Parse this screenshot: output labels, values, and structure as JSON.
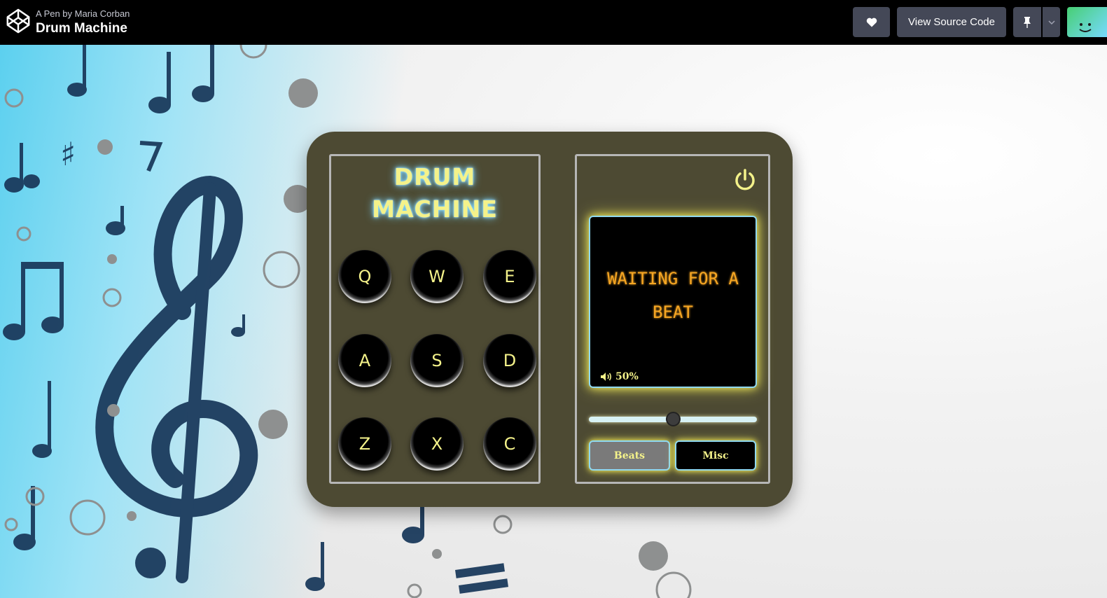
{
  "header": {
    "pen_by": "A Pen by Maria Corban",
    "title": "Drum Machine",
    "heart_icon": "heart-icon",
    "view_source_label": "View Source Code",
    "pin_icon": "pin-icon",
    "caret_icon": "chevron-down-icon",
    "avatar_icon": "avatar"
  },
  "machine": {
    "title_line1": "DRUM",
    "title_line2": "MACHINE",
    "pads": [
      "Q",
      "W",
      "E",
      "A",
      "S",
      "D",
      "Z",
      "X",
      "C"
    ],
    "display_line1": "WAITING FOR A",
    "display_line2": "BEAT",
    "volume_label": "50%",
    "volume_value": 0.5,
    "bank_buttons": [
      "Beats",
      "Misc"
    ]
  },
  "colors": {
    "topbar": "#000000",
    "button": "#444857",
    "machine_body": "#4d4a33",
    "title": "#f4f28a",
    "display_text": "#f6a623",
    "glow": "#f6f05a"
  }
}
